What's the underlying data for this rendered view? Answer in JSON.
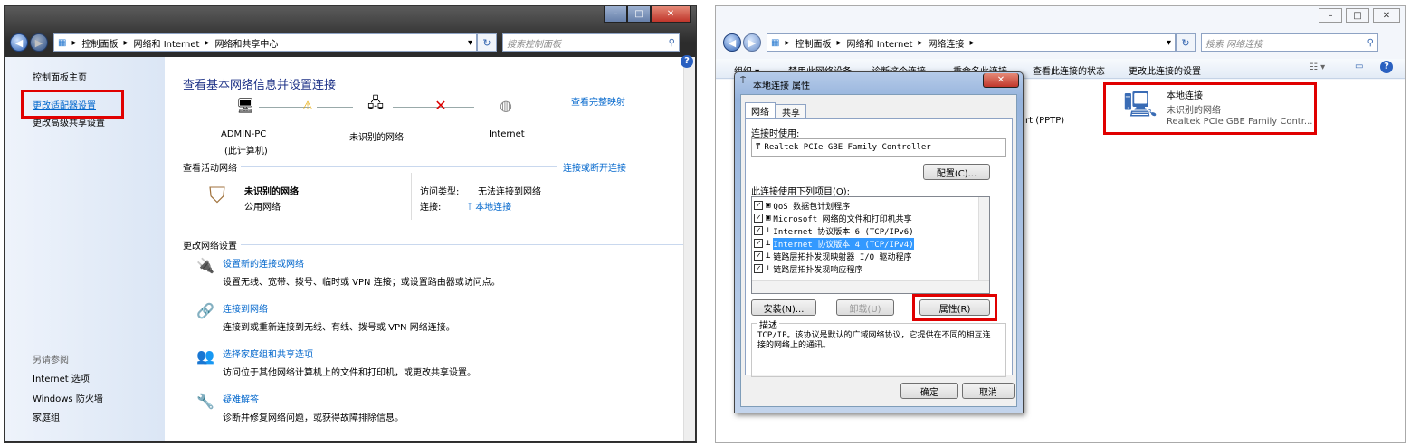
{
  "left_window": {
    "breadcrumb": [
      "控制面板",
      "网络和 Internet",
      "网络和共享中心"
    ],
    "search_placeholder": "搜索控制面板",
    "sidebar": {
      "home": "控制面板主页",
      "adapter_settings": "更改适配器设置",
      "advanced_sharing": "更改高级共享设置",
      "see_also": "另请参阅",
      "internet_options": "Internet 选项",
      "firewall": "Windows 防火墙",
      "homegroup": "家庭组"
    },
    "title": "查看基本网络信息并设置连接",
    "see_full_map": "查看完整映射",
    "map": {
      "computer": "ADMIN-PC",
      "computer_sub": "(此计算机)",
      "network": "未识别的网络",
      "internet": "Internet"
    },
    "active_networks_label": "查看活动网络",
    "connect_disconnect": "连接或断开连接",
    "active_network": {
      "name": "未识别的网络",
      "type": "公用网络",
      "access_type_label": "访问类型:",
      "access_type_value": "无法连接到网络",
      "connections_label": "连接:",
      "connections_value": "本地连接"
    },
    "change_settings_label": "更改网络设置",
    "tasks": [
      {
        "title": "设置新的连接或网络",
        "desc": "设置无线、宽带、拨号、临时或 VPN 连接；或设置路由器或访问点。"
      },
      {
        "title": "连接到网络",
        "desc": "连接到或重新连接到无线、有线、拨号或 VPN 网络连接。"
      },
      {
        "title": "选择家庭组和共享选项",
        "desc": "访问位于其他网络计算机上的文件和打印机，或更改共享设置。"
      },
      {
        "title": "疑难解答",
        "desc": "诊断并修复网络问题，或获得故障排除信息。"
      }
    ]
  },
  "right_window": {
    "breadcrumb": [
      "控制面板",
      "网络和 Internet",
      "网络连接"
    ],
    "search_placeholder": "搜索 网络连接",
    "toolbar": [
      "组织 ▾",
      "禁用此网络设备",
      "诊断这个连接",
      "重命名此连接",
      "查看此连接的状态",
      "更改此连接的设置"
    ],
    "bg_text": "rt (PPTP)",
    "adapter": {
      "name": "本地连接",
      "status": "未识别的网络",
      "device": "Realtek PCIe GBE Family Contr..."
    },
    "dialog": {
      "title": "本地连接 属性",
      "tabs": [
        "网络",
        "共享"
      ],
      "connect_using_label": "连接时使用:",
      "adapter_name": "Realtek PCIe GBE Family Controller",
      "configure_btn": "配置(C)...",
      "items_label": "此连接使用下列项目(O):",
      "items": [
        "QoS 数据包计划程序",
        "Microsoft 网络的文件和打印机共享",
        "Internet 协议版本 6 (TCP/IPv6)",
        "Internet 协议版本 4 (TCP/IPv4)",
        "链路层拓扑发现映射器 I/O 驱动程序",
        "链路层拓扑发现响应程序"
      ],
      "install_btn": "安装(N)...",
      "uninstall_btn": "卸载(U)",
      "properties_btn": "属性(R)",
      "description_label": "描述",
      "description": "TCP/IP。该协议是默认的广域网络协议，它提供在不同的相互连接的网络上的通讯。",
      "ok_btn": "确定",
      "cancel_btn": "取消"
    }
  },
  "colors": {
    "link": "#0066cc",
    "highlight_box": "#e00000",
    "selection": "#3399ff"
  }
}
